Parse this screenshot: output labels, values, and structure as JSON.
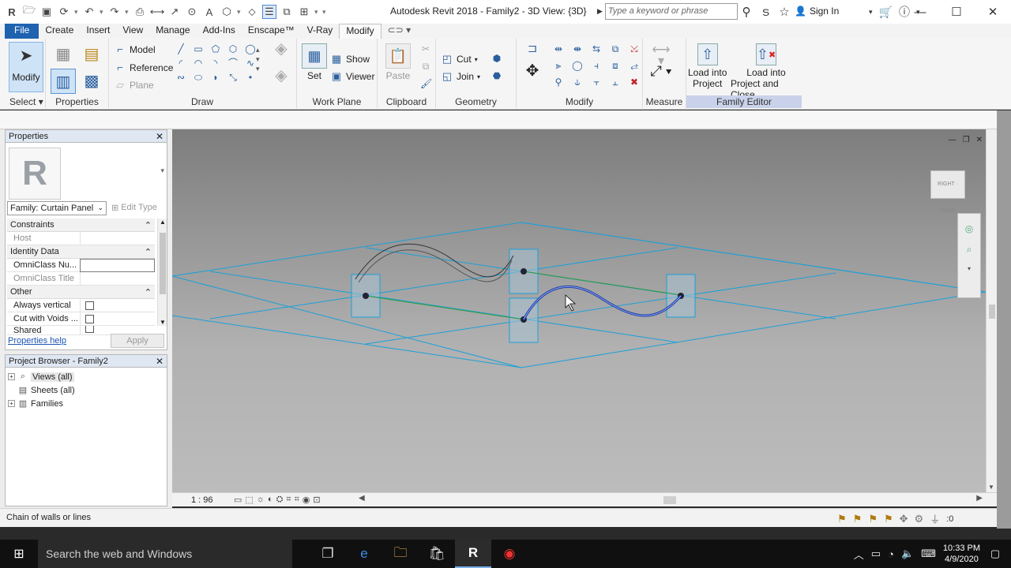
{
  "titlebar": {
    "app_title": "Autodesk Revit 2018 -    Family2 - 3D View: {3D}",
    "search_placeholder": "Type a keyword or phrase",
    "signin": "Sign In"
  },
  "tabs": [
    "File",
    "Create",
    "Insert",
    "View",
    "Manage",
    "Add-Ins",
    "Enscape™",
    "V-Ray",
    "Modify"
  ],
  "active_tab": "Modify",
  "ribbon": {
    "select": {
      "modify": "Modify",
      "label": "Select"
    },
    "properties": {
      "label": "Properties"
    },
    "draw": {
      "model": "Model",
      "reference": "Reference",
      "plane": "Plane",
      "label": "Draw"
    },
    "workplane": {
      "set": "Set",
      "show": "Show",
      "viewer": "Viewer",
      "label": "Work Plane"
    },
    "clipboard": {
      "paste": "Paste",
      "label": "Clipboard"
    },
    "geometry": {
      "cut": "Cut",
      "join": "Join",
      "label": "Geometry"
    },
    "modify": {
      "label": "Modify"
    },
    "measure": {
      "label": "Measure"
    },
    "family_editor": {
      "load_project": [
        "Load into",
        "Project"
      ],
      "load_close": [
        "Load into",
        "Project and Close"
      ],
      "label": "Family Editor"
    }
  },
  "properties_palette": {
    "title": "Properties",
    "family_selector": "Family: Curtain Panel",
    "edit_type": "Edit Type",
    "groups": [
      {
        "name": "Constraints",
        "rows": [
          {
            "key": "Host",
            "dim": true,
            "type": "empty"
          }
        ]
      },
      {
        "name": "Identity Data",
        "rows": [
          {
            "key": "OmniClass Nu...",
            "dim": false,
            "type": "edit"
          },
          {
            "key": "OmniClass Title",
            "dim": true,
            "type": "empty"
          }
        ]
      },
      {
        "name": "Other",
        "rows": [
          {
            "key": "Always vertical",
            "dim": false,
            "type": "checkbox"
          },
          {
            "key": "Cut with Voids ...",
            "dim": false,
            "type": "checkbox"
          },
          {
            "key": "Shared",
            "dim": false,
            "type": "checkbox"
          }
        ]
      }
    ],
    "help_link": "Properties help",
    "apply": "Apply"
  },
  "project_browser": {
    "title": "Project Browser - Family2",
    "items": [
      "Views (all)",
      "Sheets (all)",
      "Families"
    ]
  },
  "view_control": {
    "scale": "1 : 96"
  },
  "status": {
    "text": "Chain of walls or lines",
    "filter_count": ":0"
  },
  "taskbar": {
    "search": "Search the web and Windows",
    "time": "10:33 PM",
    "date": "4/9/2020"
  },
  "colors": {
    "file_tab": "#1e62b0",
    "grid_line": "#1aa0d8",
    "selected_curve": "#1f3a9c",
    "family_editor_band": "#c9d2ea"
  }
}
